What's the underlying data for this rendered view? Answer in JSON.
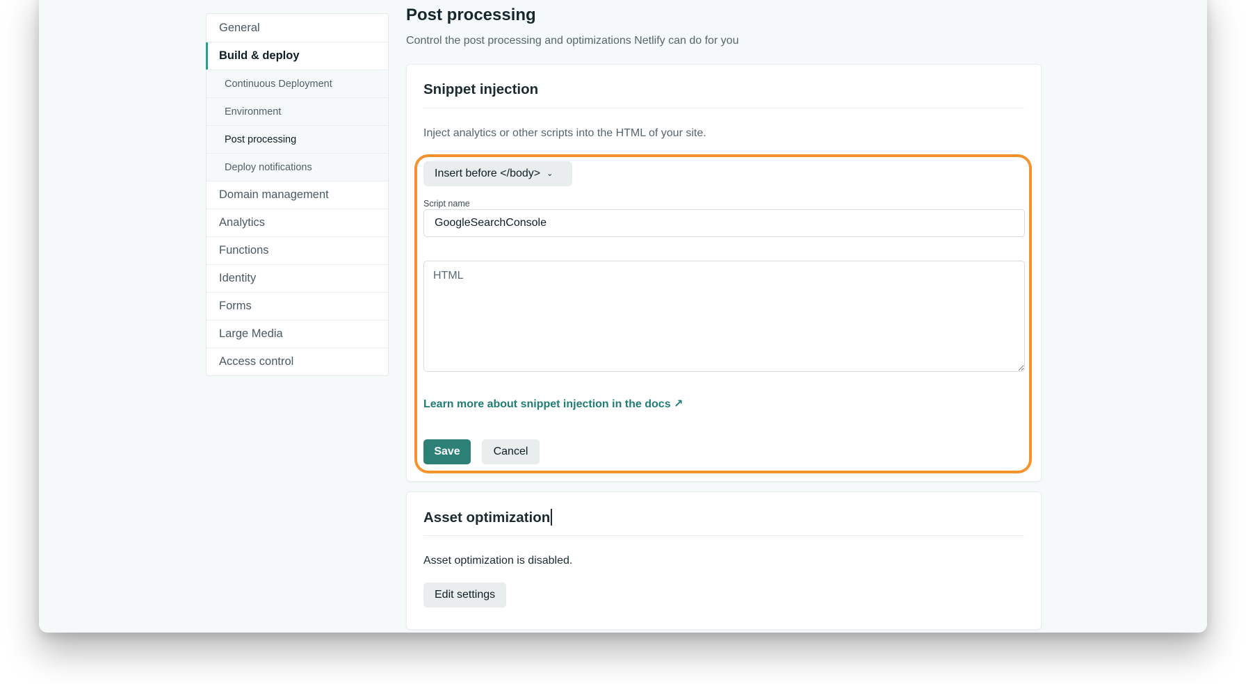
{
  "sidebar": {
    "items": [
      {
        "label": "General"
      },
      {
        "label": "Build & deploy"
      },
      {
        "label": "Continuous Deployment"
      },
      {
        "label": "Environment"
      },
      {
        "label": "Post processing"
      },
      {
        "label": "Deploy notifications"
      },
      {
        "label": "Domain management"
      },
      {
        "label": "Analytics"
      },
      {
        "label": "Functions"
      },
      {
        "label": "Identity"
      },
      {
        "label": "Forms"
      },
      {
        "label": "Large Media"
      },
      {
        "label": "Access control"
      }
    ]
  },
  "page": {
    "title": "Post processing",
    "subtitle": "Control the post processing and optimizations Netlify can do for you"
  },
  "snippet": {
    "title": "Snippet injection",
    "description": "Inject analytics or other scripts into the HTML of your site.",
    "position_select": "Insert before </body>",
    "script_name_label": "Script name",
    "script_name_value": "GoogleSearchConsole",
    "html_placeholder": "HTML",
    "docs_link": "Learn more about snippet injection in the docs ↗",
    "save_label": "Save",
    "cancel_label": "Cancel",
    "highlight_color": "#f5922b"
  },
  "asset": {
    "title": "Asset optimization",
    "status": "Asset optimization is disabled.",
    "edit_label": "Edit settings"
  },
  "colors": {
    "accent": "#2a9d8f",
    "primary_button": "#2c8076",
    "link": "#1f7d73"
  }
}
